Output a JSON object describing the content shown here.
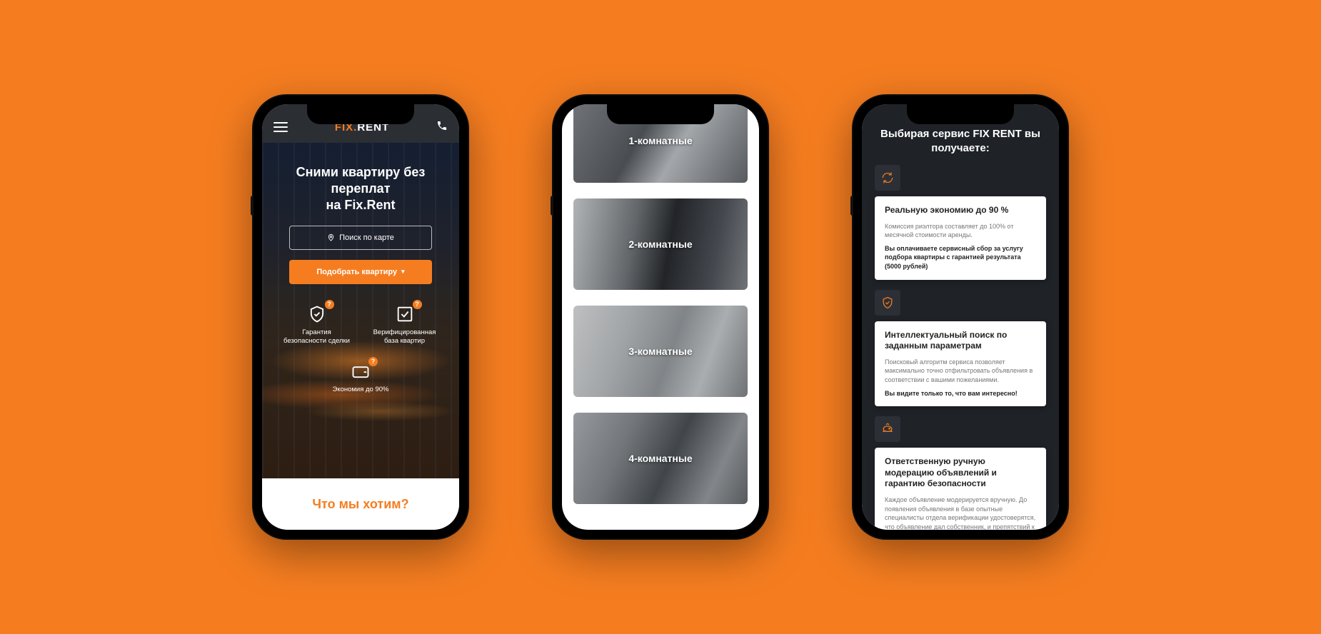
{
  "phone1": {
    "logo_prefix": "FIX.",
    "logo_suffix": "RENT",
    "hero_title_line1": "Сними квартиру без переплат",
    "hero_title_line2": "на Fix.Rent",
    "map_search_label": "Поиск по карте",
    "find_apartment_label": "Подобрать квартиру",
    "features": [
      {
        "label": "Гарантия\nбезопасности сделки",
        "icon": "shield"
      },
      {
        "label": "Верифицированная\nбаза квартир",
        "icon": "verified"
      },
      {
        "label": "Экономия до 90%",
        "icon": "wallet"
      }
    ],
    "footer_heading": "Что мы хотим?"
  },
  "phone2": {
    "rooms": [
      "1-комнатные",
      "2-комнатные",
      "3-комнатные",
      "4-комнатные"
    ]
  },
  "phone3": {
    "heading": "Выбирая сервис FIX RENT вы получаете:",
    "benefits": [
      {
        "icon": "refresh",
        "title": "Реальную экономию до 90 %",
        "desc": "Комиссия риэлтора составляет до 100% от месячной стоимости аренды.",
        "strong": "Вы оплачиваете сервисный сбор за услугу подбора квартиры с гарантией результата (5000 рублей)"
      },
      {
        "icon": "shield-check",
        "title": "Интеллектуальный поиск по заданным параметрам",
        "desc": "Поисковый алгоритм сервиса позволяет максимально точно отфильтровать объявления в соответствии с вашими пожеланиями.",
        "strong": "Вы видите только то, что вам интересно!"
      },
      {
        "icon": "piggy",
        "title": "Ответственную ручную модерацию объявлений и гарантию безопасности",
        "desc": "Каждое объявление модерируется вручную. До появления объявления в базе опытные специалисты отдела верификации удостоверятся, что объявление дал собственник, и препятствий к сдаче квартиры в аренду не имеется.",
        "strong": ""
      }
    ]
  }
}
